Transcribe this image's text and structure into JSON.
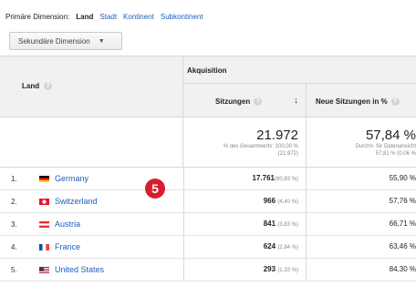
{
  "dimension_bar": {
    "label": "Primäre Dimension:",
    "active": "Land",
    "links": [
      "Stadt",
      "Kontinent",
      "Subkontinent"
    ]
  },
  "secondary_dimension": {
    "label": "Sekundäre Dimension",
    "icon": "chevron-down-icon"
  },
  "table": {
    "dimension_header": "Land",
    "group_header": "Akquisition",
    "columns": {
      "sessions": {
        "label": "Sitzungen",
        "sort_icon": "sort-down-arrow-icon"
      },
      "new_sessions": {
        "label": "Neue Sitzungen in %"
      }
    },
    "totals": {
      "sessions_value": "21.972",
      "sessions_note1": "% des Gesamtwerts: 100,00 %",
      "sessions_note2": "(21.972)",
      "new_value": "57,84 %",
      "new_note1": "Durchn. für Datenansicht",
      "new_note2": "57,81 % (0,06 %"
    },
    "rows": [
      {
        "num": "1.",
        "country": "Germany",
        "flag": "germany-flag-icon",
        "sessions": "17.761",
        "pct": "(80,83 %)",
        "new": "55,90 %"
      },
      {
        "num": "2.",
        "country": "Switzerland",
        "flag": "switzerland-flag-icon",
        "sessions": "966",
        "pct": "(4,40 %)",
        "new": "57,76 %"
      },
      {
        "num": "3.",
        "country": "Austria",
        "flag": "austria-flag-icon",
        "sessions": "841",
        "pct": "(3,83 %)",
        "new": "66,71 %"
      },
      {
        "num": "4.",
        "country": "France",
        "flag": "france-flag-icon",
        "sessions": "624",
        "pct": "(2,84 %)",
        "new": "63,46 %"
      },
      {
        "num": "5.",
        "country": "United States",
        "flag": "usa-flag-icon",
        "sessions": "293",
        "pct": "(1,33 %)",
        "new": "84,30 %"
      }
    ]
  },
  "annotation_badge": "5",
  "colors": {
    "link": "#1a5fbe",
    "badge": "#d81e2e",
    "header_bg": "#f1f1f1"
  }
}
